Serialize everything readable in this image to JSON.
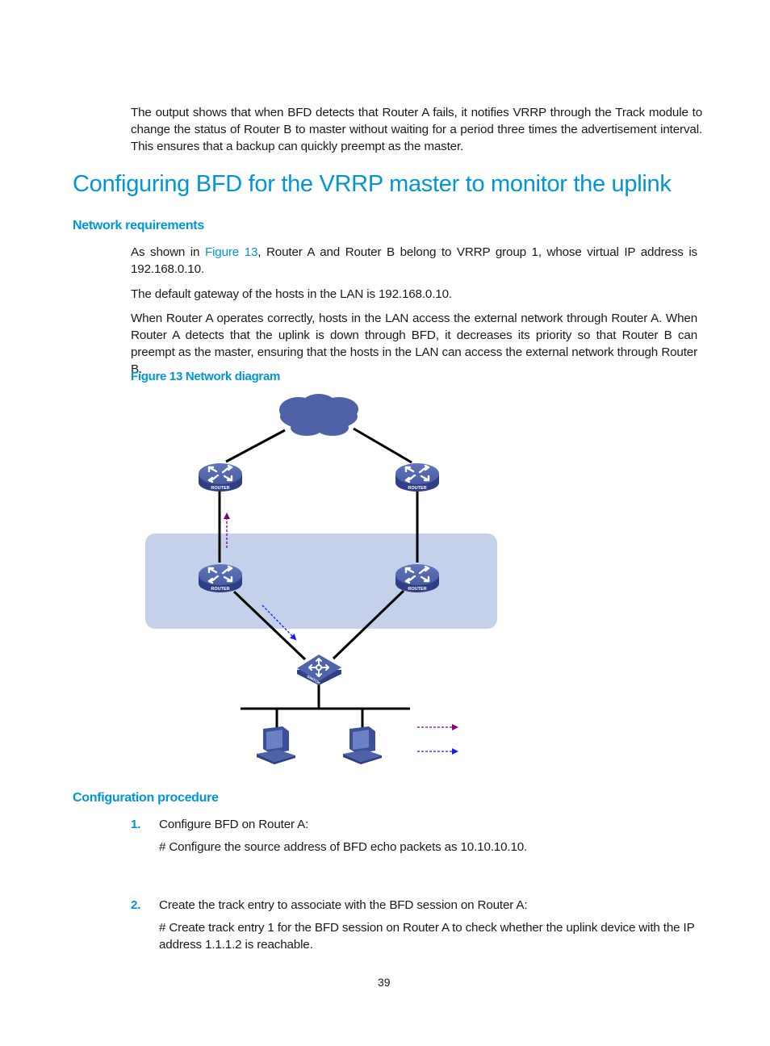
{
  "intro_paragraph": "The output shows that when BFD detects that Router A fails, it notifies VRRP through the Track module to change the status of Router B to master without waiting for a period three times the advertisement interval. This ensures that a backup can quickly preempt as the master.",
  "section_title": "Configuring BFD for the VRRP master to monitor the uplink",
  "network_requirements": {
    "heading": "Network requirements",
    "para1_prefix": "As shown in ",
    "para1_link": "Figure 13",
    "para1_suffix": ", Router A and Router B belong to VRRP group 1, whose virtual IP address is 192.168.0.10.",
    "para2": "The default gateway of the hosts in the LAN is 192.168.0.10.",
    "para3": "When Router A operates correctly, hosts in the LAN access the external network through Router A. When Router A detects that the uplink is down through BFD, it decreases its priority so that Router B can preempt as the master, ensuring that the hosts in the LAN can access the external network through Router B."
  },
  "figure": {
    "caption": "Figure 13 Network diagram",
    "router_label": "ROUTER",
    "switch_label": "SWITCH",
    "colors": {
      "device": "#4f62a8",
      "device_dark": "#2f3f86",
      "cloud": "#4f62a8",
      "vrrp_group_bg": "#c5d1ea",
      "track_arrow": "#800080",
      "bfd_arrow": "#1a1aff"
    }
  },
  "configuration_procedure": {
    "heading": "Configuration procedure",
    "steps": [
      {
        "number": "1.",
        "title": "Configure BFD on Router A:",
        "detail": "# Configure the source address of BFD echo packets as 10.10.10.10."
      },
      {
        "number": "2.",
        "title": "Create the track entry to associate with the BFD session on Router A:",
        "detail": "# Create track entry 1 for the BFD session on Router A to check whether the uplink device with the IP address 1.1.1.2 is reachable."
      }
    ]
  },
  "page_number": "39"
}
